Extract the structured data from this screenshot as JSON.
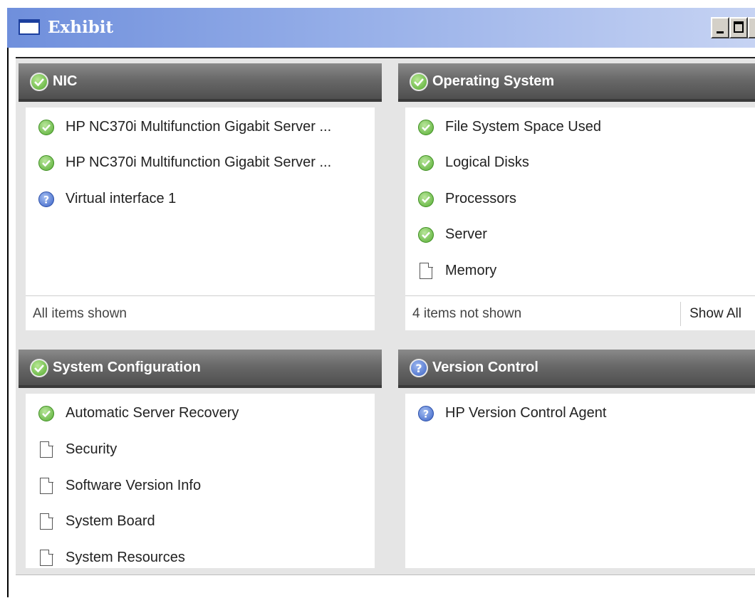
{
  "window": {
    "title": "Exhibit"
  },
  "panels": {
    "nic": {
      "title": "NIC",
      "status": "ok",
      "items": [
        {
          "label": "HP NC370i Multifunction Gigabit Server ...",
          "status": "ok"
        },
        {
          "label": "HP NC370i Multifunction Gigabit Server ...",
          "status": "ok"
        },
        {
          "label": "Virtual interface 1",
          "status": "unknown"
        }
      ],
      "footer": "All items shown"
    },
    "os": {
      "title": "Operating System",
      "status": "ok",
      "items": [
        {
          "label": "File System Space Used",
          "status": "ok"
        },
        {
          "label": "Logical Disks",
          "status": "ok"
        },
        {
          "label": "Processors",
          "status": "ok"
        },
        {
          "label": "Server",
          "status": "ok"
        },
        {
          "label": "Memory",
          "status": "document"
        }
      ],
      "footer": "4 items not shown",
      "show_all": "Show All"
    },
    "syscfg": {
      "title": "System Configuration",
      "status": "ok",
      "items": [
        {
          "label": "Automatic Server Recovery",
          "status": "ok"
        },
        {
          "label": "Security",
          "status": "document"
        },
        {
          "label": "Software Version Info",
          "status": "document"
        },
        {
          "label": "System Board",
          "status": "document"
        },
        {
          "label": "System Resources",
          "status": "document"
        }
      ]
    },
    "version": {
      "title": "Version Control",
      "status": "unknown",
      "items": [
        {
          "label": "HP Version Control Agent",
          "status": "unknown"
        }
      ]
    }
  },
  "colors": {
    "ok": "#56ad33",
    "unknown": "#3a62c6",
    "header": "#5a5a5a",
    "title_bar": "#7b97df"
  }
}
